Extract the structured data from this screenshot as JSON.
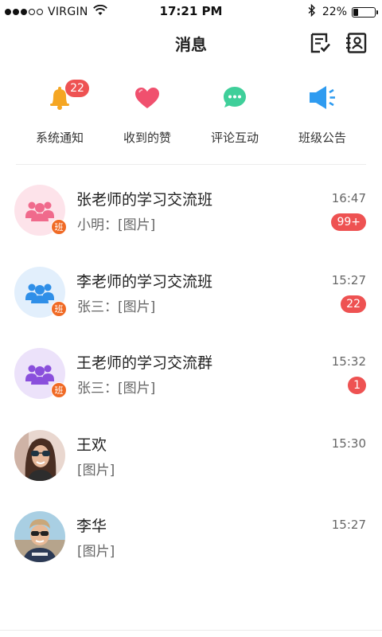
{
  "status_bar": {
    "carrier": "VIRGIN",
    "time": "17:21 PM",
    "battery": "22%",
    "battery_level": 0.22
  },
  "header": {
    "title": "消息",
    "icons": [
      "checklist-icon",
      "contacts-icon"
    ]
  },
  "quick_actions": [
    {
      "label": "系统通知",
      "icon": "bell-icon",
      "color": "#f5a623",
      "badge": "22"
    },
    {
      "label": "收到的赞",
      "icon": "heart-icon",
      "color": "#f0506e"
    },
    {
      "label": "评论互动",
      "icon": "comment-icon",
      "color": "#3fcf9a"
    },
    {
      "label": "班级公告",
      "icon": "megaphone-icon",
      "color": "#2e9bf0"
    }
  ],
  "conversations": [
    {
      "name": "张老师的学习交流班",
      "message": "小明：[图片]",
      "time": "16:47",
      "unread": "99+",
      "avatar": "group-icon",
      "avatar_color": "#f06a8c",
      "avatar_bg": "#fde3ea",
      "tag": "班"
    },
    {
      "name": "李老师的学习交流班",
      "message": "张三：[图片]",
      "time": "15:27",
      "unread": "22",
      "avatar": "group-icon",
      "avatar_color": "#2f8fe8",
      "avatar_bg": "#e2effc",
      "tag": "班"
    },
    {
      "name": "王老师的学习交流群",
      "message": "张三：[图片]",
      "time": "15:32",
      "unread": "1",
      "avatar": "group-icon",
      "avatar_color": "#8a4fdc",
      "avatar_bg": "#ece2fa",
      "tag": "班"
    },
    {
      "name": "王欢",
      "message": "[图片]",
      "time": "15:30",
      "avatar": "user-photo-woman"
    },
    {
      "name": "李华",
      "message": "[图片]",
      "time": "15:27",
      "avatar": "user-photo-man"
    }
  ],
  "colors": {
    "badge": "#ee5252",
    "class_tag": "#f06a25"
  }
}
